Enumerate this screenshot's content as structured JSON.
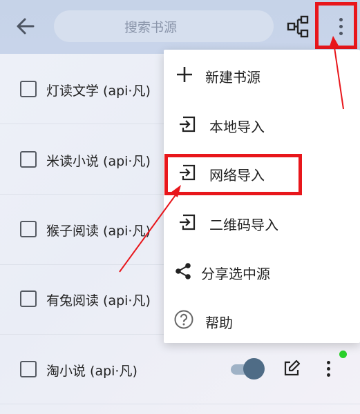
{
  "header": {
    "search_placeholder": "搜索书源",
    "icons": [
      "back-arrow-icon",
      "tree-icon",
      "more-vertical-icon"
    ]
  },
  "sources": [
    {
      "name": "灯读文学 (api·凡)",
      "checked": false
    },
    {
      "name": "米读小说 (api·凡)",
      "checked": false
    },
    {
      "name": "猴子阅读 (api·凡)",
      "checked": false
    },
    {
      "name": "有兔阅读 (api·凡)",
      "checked": false
    },
    {
      "name": "淘小说 (api·凡)",
      "checked": false,
      "enabled": true
    }
  ],
  "menu": {
    "items": [
      {
        "label": "新建书源",
        "icon": "plus-icon"
      },
      {
        "label": "本地导入",
        "icon": "import-icon"
      },
      {
        "label": "网络导入",
        "icon": "import-icon"
      },
      {
        "label": "二维码导入",
        "icon": "import-icon"
      },
      {
        "label": "分享选中源",
        "icon": "share-icon"
      },
      {
        "label": "帮助",
        "icon": "help-icon"
      }
    ]
  },
  "colors": {
    "topbar": "#c6d3e8",
    "highlight": "#e8161b",
    "status_dot": "#2ad12a"
  }
}
